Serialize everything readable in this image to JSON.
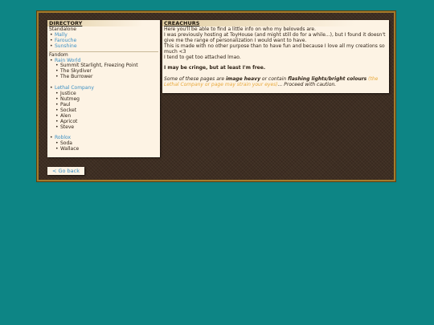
{
  "directory": {
    "title": "DIRECTORY",
    "standalone_label": "Standalone",
    "standalone_items": [
      "Mally",
      "Farouche",
      "Sunshine"
    ],
    "fandom_label": "Fandom",
    "rain_world": {
      "label": "Rain World",
      "items": [
        "Summit Starlight, Freezing Point",
        "The Skydiver",
        "The Burrower"
      ]
    },
    "lethal_company": {
      "label": "Lethal Company",
      "items": [
        "Justice",
        "Nutmeg",
        "Paul",
        "Socket",
        "Alen",
        "Apricot",
        "Steve"
      ]
    },
    "roblox": {
      "label": "Roblox",
      "items": [
        "Soda",
        "Wallace"
      ]
    }
  },
  "creachurs": {
    "title": "CREACHURS",
    "line1": "Here you'll be able to find a little info on who my beloveds are.",
    "line2": "I was previously hosting at ToyHouse (and might still do for a while...), but I found it doesn't give me the range of personalization I would want to have.",
    "line3": "This is made with no other purpose than to have fun and because I love all my creations so much <3",
    "line4": "I tend to get too attached lmao.",
    "cringe": "I may be cringe, but at least I'm free.",
    "warn_a": "Some of these pages are ",
    "warn_b": "image heavy",
    "warn_c": " or contain ",
    "warn_d": "flashing lights/bright colours",
    "warn_e": " (the Lethal Company or page may strain your eyes)",
    "warn_f": "... Proceed with caution."
  },
  "back_button": "< Go back",
  "colors": {
    "background": "#0d8585",
    "link": "#3a8fc4",
    "accent": "#e8a83a",
    "frame_border": "#a37a2c"
  }
}
